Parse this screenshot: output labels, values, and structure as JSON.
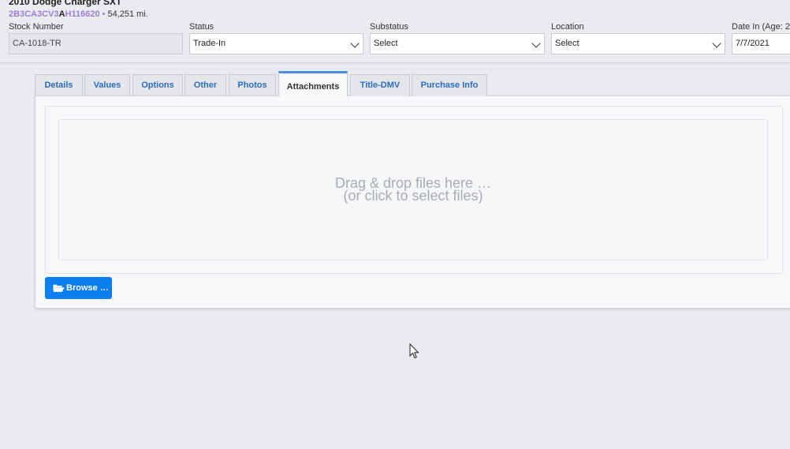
{
  "vehicle": {
    "title": "2010 Dodge Charger SXT",
    "vin_part1": "2B3CA3CV3",
    "vin_part2": "A",
    "vin_part3": "H116620",
    "separator": "•",
    "mileage": "54,251 mi."
  },
  "fields": {
    "stock_number": {
      "label": "Stock Number",
      "value": "CA-1018-TR"
    },
    "status": {
      "label": "Status",
      "value": "Trade-In"
    },
    "substatus": {
      "label": "Substatus",
      "value": "Select"
    },
    "location": {
      "label": "Location",
      "value": "Select"
    },
    "date_in": {
      "label": "Date In (Age: 2",
      "value": "7/7/2021"
    }
  },
  "tabs": [
    {
      "label": "Details"
    },
    {
      "label": "Values"
    },
    {
      "label": "Options"
    },
    {
      "label": "Other"
    },
    {
      "label": "Photos"
    },
    {
      "label": "Attachments"
    },
    {
      "label": "Title-DMV"
    },
    {
      "label": "Purchase Info"
    }
  ],
  "active_tab": "Attachments",
  "dropzone": {
    "line1": "Drag & drop files here …",
    "line2": "(or click to select files)"
  },
  "browse_button": {
    "label": "Browse …",
    "icon": "folder-open-icon"
  },
  "colors": {
    "accent": "#0b7ef0",
    "tab_link": "#2b6cc4",
    "vin_highlight": "#9b7fd6",
    "active_tab_border": "#4a90e2"
  }
}
